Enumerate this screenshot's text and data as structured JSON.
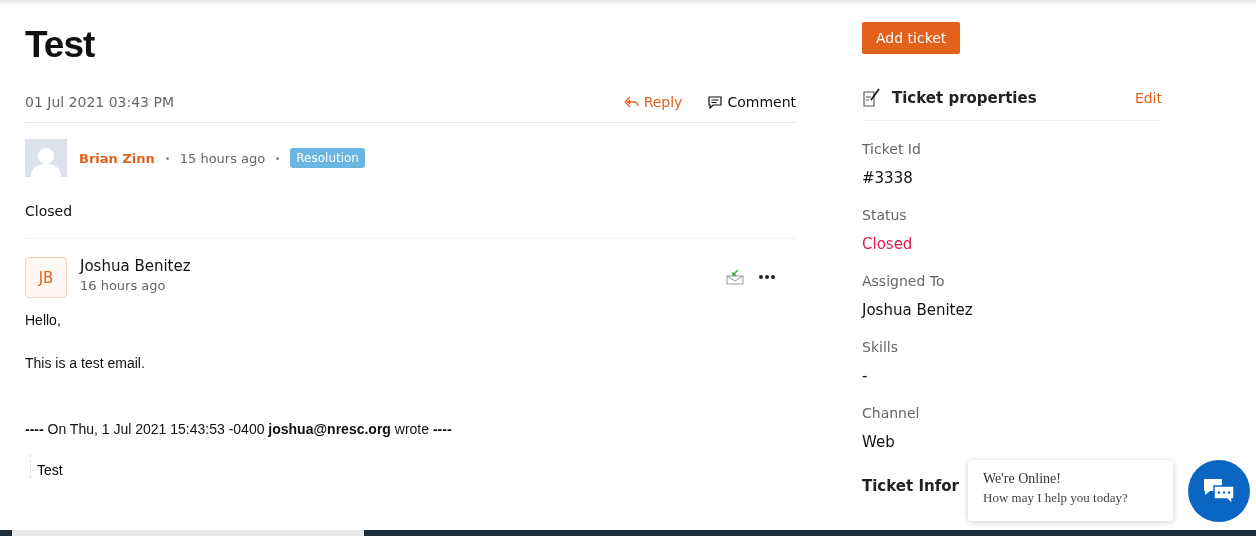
{
  "title": "Test",
  "date": "01 Jul 2021 03:43 PM",
  "actions": [
    {
      "kind": "reply",
      "label": "Reply"
    },
    {
      "kind": "comment",
      "label": "Comment"
    }
  ],
  "resolution": {
    "author": "Brian Zinn",
    "time": "15 hours ago",
    "tag": "Resolution",
    "text": "Closed"
  },
  "thread": {
    "initials": "JB",
    "author": "Joshua Benitez",
    "time": "16 hours ago",
    "body": [
      "Hello,",
      "This is a test email."
    ],
    "quote_header": "**----** On  Thu, 1 Jul 2021 15:43:53 -0400 **joshua@nresc.org**  wrote **----**",
    "quote": "Test"
  },
  "add_ticket": "Add ticket",
  "properties": {
    "title": "Ticket properties",
    "edit": "Edit",
    "fields": [
      {
        "label": "Ticket Id",
        "value": "#3338",
        "kind": "plain"
      },
      {
        "label": "Status",
        "value": "Closed",
        "kind": "status"
      },
      {
        "label": "Assigned To",
        "value": "Joshua Benitez",
        "kind": "plain"
      },
      {
        "label": "Skills",
        "value": "-",
        "kind": "plain"
      },
      {
        "label": "Channel",
        "value": "Web",
        "kind": "plain"
      }
    ],
    "next_section": "Ticket Infor"
  },
  "chat": {
    "title": "We're Online!",
    "subtitle": "How may I help you today?"
  }
}
